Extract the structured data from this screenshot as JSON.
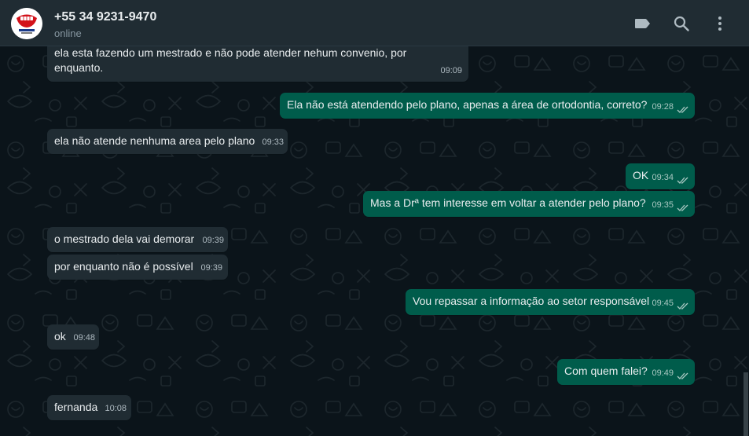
{
  "header": {
    "contact_name": "+55 34 9231-9470",
    "status": "online",
    "icons": [
      "label-icon",
      "search-icon",
      "menu-icon"
    ]
  },
  "colors": {
    "header_bg": "#202c33",
    "chat_bg": "#0b141a",
    "incoming_bubble": "#202c33",
    "outgoing_bubble": "#005c4b",
    "text": "#e9edef",
    "read_ticks": "#a9c8c2"
  },
  "messages": [
    {
      "direction": "in",
      "text_line1": "ela esta  fazendo um mestrado e não pode atender nehum convenio, por",
      "text_line2": "enquanto.",
      "time": "09:09"
    },
    {
      "direction": "out",
      "text": "Ela não está atendendo pelo plano, apenas a área de ortodontia, correto?",
      "time": "09:28",
      "status": "read"
    },
    {
      "direction": "in",
      "text": "ela não atende nenhuma area pelo plano",
      "time": "09:33"
    },
    {
      "direction": "out",
      "text": "OK",
      "time": "09:34",
      "status": "read"
    },
    {
      "direction": "out",
      "text": "Mas a Drª tem interesse em voltar a atender pelo plano?",
      "time": "09:35",
      "status": "read"
    },
    {
      "direction": "in",
      "text": "o mestrado dela vai demorar",
      "time": "09:39"
    },
    {
      "direction": "in",
      "text": "por enquanto não é possível",
      "time": "09:39"
    },
    {
      "direction": "out",
      "text": "Vou repassar a informação ao setor responsável",
      "time": "09:45",
      "status": "read"
    },
    {
      "direction": "in",
      "text": "ok",
      "time": "09:48"
    },
    {
      "direction": "out",
      "text": "Com quem falei?",
      "time": "09:49",
      "status": "read"
    },
    {
      "direction": "in",
      "text": "fernanda",
      "time": "10:08"
    }
  ]
}
